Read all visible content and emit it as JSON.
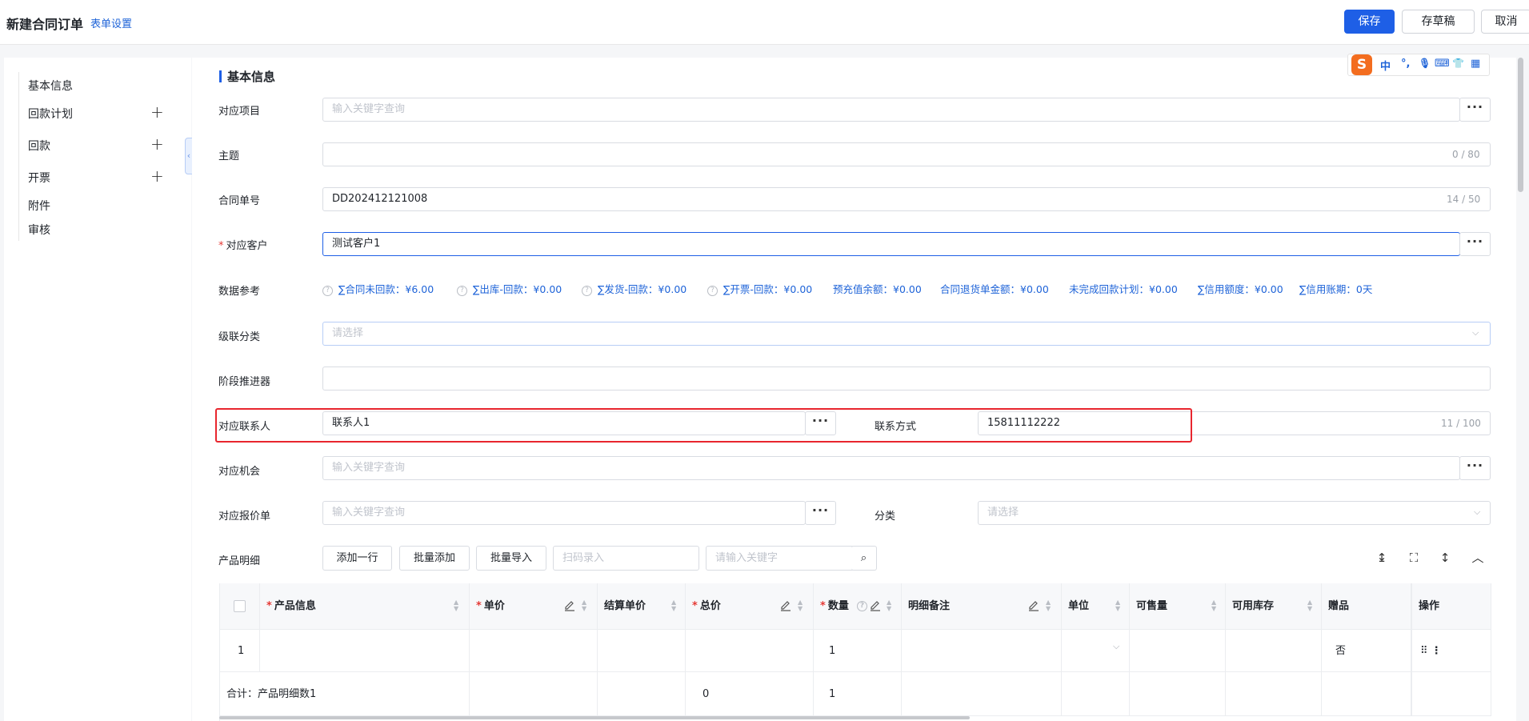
{
  "header": {
    "title": "新建合同订单",
    "settings_link": "表单设置",
    "save_label": "保存",
    "draft_label": "存草稿",
    "cancel_label": "取消"
  },
  "sidebar": {
    "items": [
      {
        "label": "基本信息",
        "has_add": false
      },
      {
        "label": "回款计划",
        "has_add": true
      },
      {
        "label": "回款",
        "has_add": true
      },
      {
        "label": "开票",
        "has_add": true
      },
      {
        "label": "附件",
        "has_add": false
      },
      {
        "label": "审核",
        "has_add": false
      }
    ]
  },
  "ime": {
    "logo": "S",
    "items": [
      "中",
      "°,",
      "🎙",
      "⌨",
      "👕",
      "▦"
    ]
  },
  "section": {
    "title": "基本信息"
  },
  "form": {
    "project": {
      "label": "对应项目",
      "placeholder": "输入关键字查询"
    },
    "subject": {
      "label": "主题",
      "value": "",
      "counter": "0 / 80"
    },
    "order_no": {
      "label": "合同单号",
      "value": "DD202412121008",
      "counter": "14 / 50"
    },
    "customer": {
      "label": "对应客户",
      "required": true,
      "value": "测试客户1"
    },
    "data_ref": {
      "label": "数据参考",
      "items": [
        {
          "text": "∑合同未回款：¥6.00",
          "help": true
        },
        {
          "text": "∑出库-回款：¥0.00",
          "help": true
        },
        {
          "text": "∑发货-回款：¥0.00",
          "help": true
        },
        {
          "text": "∑开票-回款：¥0.00",
          "help": true
        },
        {
          "text": "预充值余额：¥0.00",
          "help": false
        },
        {
          "text": "合同退货单金额：¥0.00",
          "help": false
        },
        {
          "text": "未完成回款计划：¥0.00",
          "help": false
        },
        {
          "text": "∑信用额度：¥0.00",
          "help": false
        },
        {
          "text": "∑信用账期：0天",
          "help": false
        }
      ]
    },
    "cascade": {
      "label": "级联分类",
      "placeholder": "请选择"
    },
    "stage": {
      "label": "阶段推进器",
      "value": ""
    },
    "contact": {
      "label": "对应联系人",
      "value": "联系人1"
    },
    "contact_method": {
      "label": "联系方式",
      "value": "15811112222",
      "counter": "11 / 100"
    },
    "opportunity": {
      "label": "对应机会",
      "placeholder": "输入关键字查询"
    },
    "quote": {
      "label": "对应报价单",
      "placeholder": "输入关键字查询"
    },
    "category": {
      "label": "分类",
      "placeholder": "请选择"
    }
  },
  "products": {
    "label": "产品明细",
    "add_row": "添加一行",
    "batch_add": "批量添加",
    "batch_import": "批量导入",
    "scan_placeholder": "扫码录入",
    "search_placeholder": "请输入关键字",
    "columns": [
      {
        "label": "产品信息",
        "required": true
      },
      {
        "label": "单价",
        "required": true
      },
      {
        "label": "结算单价",
        "required": false
      },
      {
        "label": "总价",
        "required": true
      },
      {
        "label": "数量",
        "required": true
      },
      {
        "label": "明细备注",
        "required": false
      },
      {
        "label": "单位",
        "required": false
      },
      {
        "label": "可售量",
        "required": false
      },
      {
        "label": "可用库存",
        "required": false
      },
      {
        "label": "赠品",
        "required": false
      },
      {
        "label": "操作",
        "required": false
      }
    ],
    "rows": [
      {
        "index": "1",
        "product": "",
        "price": "",
        "settle_price": "",
        "total": "",
        "qty": "1",
        "note": "",
        "unit": "",
        "saleable": "",
        "stock": "",
        "gift": "否"
      }
    ],
    "summary": {
      "label": "合计：产品明细数1",
      "total": "0",
      "qty": "1"
    }
  }
}
